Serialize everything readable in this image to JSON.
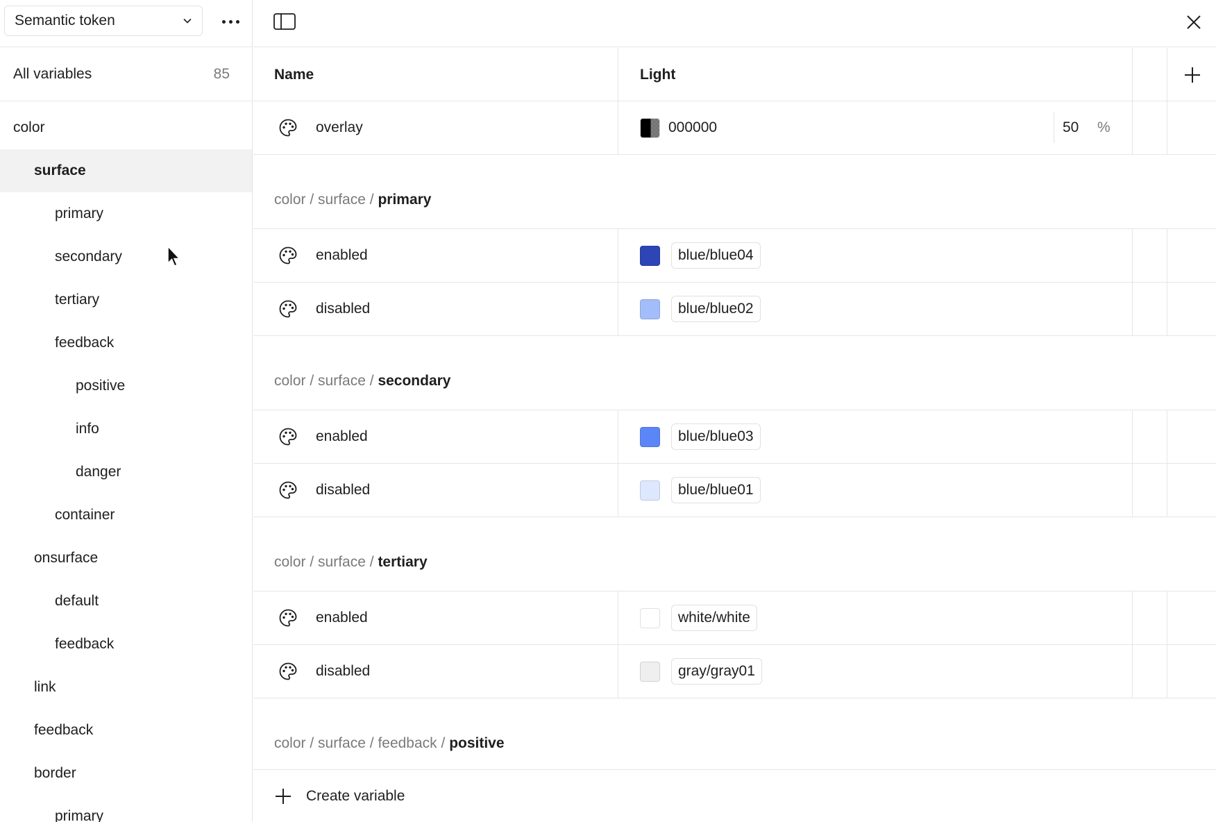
{
  "sidebar": {
    "collection_label": "Semantic token",
    "all_variables_label": "All variables",
    "all_variables_count": "85",
    "tree": [
      {
        "label": "color",
        "level": 0,
        "selected": false
      },
      {
        "label": "surface",
        "level": 1,
        "selected": true
      },
      {
        "label": "primary",
        "level": 2,
        "selected": false
      },
      {
        "label": "secondary",
        "level": 2,
        "selected": false
      },
      {
        "label": "tertiary",
        "level": 2,
        "selected": false
      },
      {
        "label": "feedback",
        "level": 2,
        "selected": false
      },
      {
        "label": "positive",
        "level": 3,
        "selected": false
      },
      {
        "label": "info",
        "level": 3,
        "selected": false
      },
      {
        "label": "danger",
        "level": 3,
        "selected": false
      },
      {
        "label": "container",
        "level": 2,
        "selected": false
      },
      {
        "label": "onsurface",
        "level": 1,
        "selected": false
      },
      {
        "label": "default",
        "level": 2,
        "selected": false
      },
      {
        "label": "feedback",
        "level": 2,
        "selected": false
      },
      {
        "label": "link",
        "level": 1,
        "selected": false
      },
      {
        "label": "feedback",
        "level": 1,
        "selected": false
      },
      {
        "label": "border",
        "level": 1,
        "selected": false
      },
      {
        "label": "primary",
        "level": 2,
        "selected": false
      }
    ]
  },
  "table": {
    "name_header": "Name",
    "mode_header": "Light",
    "overlay": {
      "name": "overlay",
      "hex": "000000",
      "opacity": "50",
      "opacity_unit": "%",
      "swatch_color": "#000000"
    },
    "groups": [
      {
        "path": [
          "color",
          "surface"
        ],
        "leaf": "primary",
        "rows": [
          {
            "name": "enabled",
            "alias": "blue/blue04",
            "swatch": "#2d45b5"
          },
          {
            "name": "disabled",
            "alias": "blue/blue02",
            "swatch": "#a3bdfa"
          }
        ]
      },
      {
        "path": [
          "color",
          "surface"
        ],
        "leaf": "secondary",
        "rows": [
          {
            "name": "enabled",
            "alias": "blue/blue03",
            "swatch": "#5b86f7"
          },
          {
            "name": "disabled",
            "alias": "blue/blue01",
            "swatch": "#dde7fd"
          }
        ]
      },
      {
        "path": [
          "color",
          "surface"
        ],
        "leaf": "tertiary",
        "rows": [
          {
            "name": "enabled",
            "alias": "white/white",
            "swatch": "#ffffff"
          },
          {
            "name": "disabled",
            "alias": "gray/gray01",
            "swatch": "#efefef"
          }
        ]
      },
      {
        "path": [
          "color",
          "surface",
          "feedback"
        ],
        "leaf": "positive",
        "rows": []
      }
    ],
    "create_label": "Create variable"
  }
}
